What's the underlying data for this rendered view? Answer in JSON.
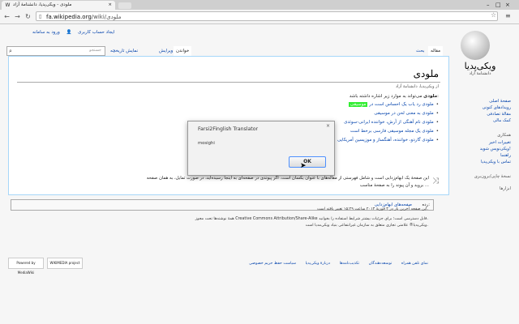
{
  "browser": {
    "tab_title": "ملودی - ویکی‌پدیا، دانشنامهٔ آزاد",
    "address": {
      "host": "fa.wikipedia.org",
      "path": "/wiki/ملودی"
    }
  },
  "personal": {
    "create_account": "ایجاد حساب کاربری",
    "login": "ورود به سامانه"
  },
  "search": {
    "placeholder": "جستجو"
  },
  "page_tabs": {
    "article": "مقاله",
    "talk": "بحث",
    "read": "خواندن",
    "edit": "ویرایش",
    "history": "نمایش تاریخچه"
  },
  "article": {
    "title": "ملودی",
    "subtitle": "از ویکی‌پدیا، دانشنامهٔ آزاد",
    "intro_bold": "ملودی",
    "intro_rest": " می‌تواند به موارد زیر اشاره داشته باشد:",
    "bullets": [
      {
        "pre": "ملودی رد یاب یک احساس است در ",
        "hl": "موسیقی"
      },
      {
        "pre": "ملودی به معنی لحن در موسیقی",
        "hl": ""
      },
      {
        "pre": "ملودی نام آهنگی از آرش، خواننده ایرانی-سوئدی",
        "hl": ""
      },
      {
        "pre": "ملودی یک مجله موسیقی فارسی برخط است",
        "hl": ""
      },
      {
        "pre": "ملودی گاردو، خواننده، آهنگساز و موزیسین آمریکایی",
        "hl": ""
      }
    ],
    "disambig_line1": "این صفحهٔ یک ابهام‌زدایی است و شامل فهرستی از مقاله‌های با عنوان یکسان است. اگر پیوندی در صفحه‌ای به اینجا رسیده‌اید، در صورت تمایل، به همان صفحه",
    "disambig_line2": "بروید و آن پیوند را به صفحهٔ مناسب ...",
    "categories_label": "رده:",
    "categories_value": "صفحه‌های ابهام‌زدایی"
  },
  "sidebar": {
    "logo_text": "ویکی‌پدیا",
    "logo_sub": "دانشنامهٔ آزاد",
    "main_links": [
      "صفحهٔ اصلی",
      "رویدادهای کنونی",
      "مقالهٔ تصادفی",
      "کمک مالی"
    ],
    "interaction_head": "همکاری",
    "interaction_links": [
      "تغییرات اخیر",
      "ویکی‌نویس شوید!",
      "راهنما",
      "تماس با ویکی‌پدیا"
    ],
    "print_head": "نسخهٔ چاپی/برون‌بری",
    "tools_head": "ابزارها"
  },
  "footer": {
    "last_edit": "این صفحه آخرین بار در ۳ فوریهٔ ۲۰۱۳ ساعت ۱۵:۲۹ تغییر یافته است.",
    "license_line1": "همهٔ نوشته‌ها تحت مجوز Creative Commons Attribution/Share-Alike قابل دسترسی است؛ برای جزئیات بیشتر شرایط استفاده را بخوانید.",
    "license_line2": "ویکی‌پدیا® علامتی تجاری متعلق به سازمان غیرانتفاعی بنیاد ویکی‌مدیا است.",
    "links": [
      "سیاست حفظ حریم خصوصی",
      "دربارهٔ ویکی‌پدیا",
      "تکذیب‌نامه‌ها",
      "توسعه‌دهندگان",
      "نمای تلفن همراه"
    ],
    "badge_wikimedia": "WIKIMEDIA project",
    "badge_mediawiki": "Powered by MediaWiki"
  },
  "dialog": {
    "title": "Farsi2Finglish Translator",
    "message": "mosighi",
    "ok": "OK",
    "close": "×"
  }
}
